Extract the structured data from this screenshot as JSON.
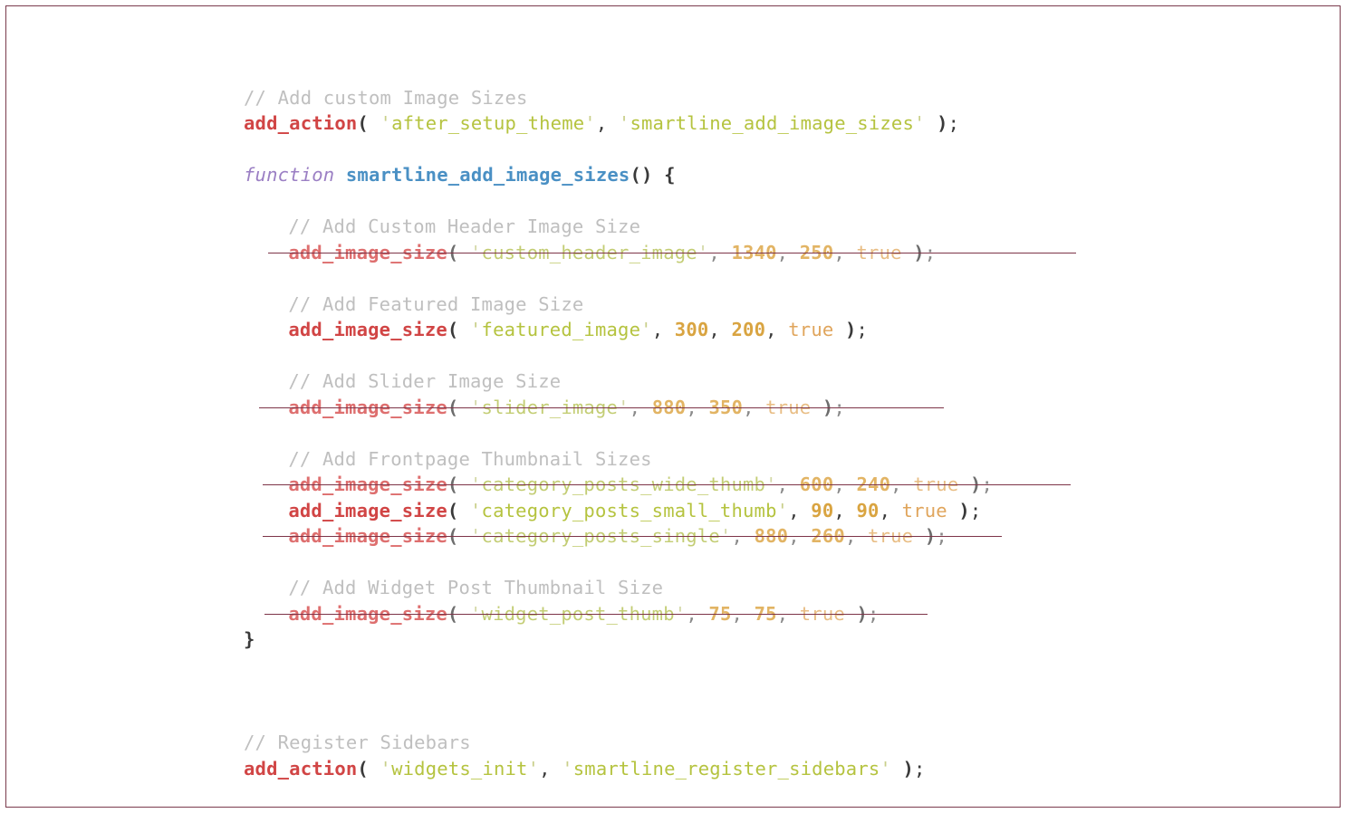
{
  "document": {
    "kind": "code-snippet-screenshot",
    "language": "PHP",
    "border_color": "#7a3b4d",
    "background_color": "#ffffff"
  },
  "theme": {
    "comment": "#bfbfbf",
    "function_call": "#d14545",
    "keyword": "#9b7fc4",
    "function_name": "#4a90c4",
    "string": "#b5c33f",
    "number": "#d9a441",
    "boolean": "#e0a55c",
    "punctuation": "#3a3a3a",
    "strikethrough": "#7d3448"
  },
  "code": {
    "lines": [
      {
        "id": "l1",
        "indent": 0,
        "struck": false,
        "text": "// Add custom Image Sizes",
        "tokens": [
          {
            "t": "comment",
            "v": "// Add custom Image Sizes"
          }
        ]
      },
      {
        "id": "l2",
        "indent": 0,
        "struck": false,
        "text": "add_action( 'after_setup_theme', 'smartline_add_image_sizes' );",
        "tokens": [
          {
            "t": "fn-call",
            "v": "add_action"
          },
          {
            "t": "punct",
            "v": "("
          },
          {
            "t": "plain",
            "v": " "
          },
          {
            "t": "quote",
            "v": "'"
          },
          {
            "t": "string",
            "v": "after_setup_theme"
          },
          {
            "t": "quote",
            "v": "'"
          },
          {
            "t": "comma",
            "v": ","
          },
          {
            "t": "plain",
            "v": " "
          },
          {
            "t": "quote",
            "v": "'"
          },
          {
            "t": "string",
            "v": "smartline_add_image_sizes"
          },
          {
            "t": "quote",
            "v": "'"
          },
          {
            "t": "plain",
            "v": " "
          },
          {
            "t": "punct",
            "v": ")"
          },
          {
            "t": "comma",
            "v": ";"
          }
        ]
      },
      {
        "id": "l3",
        "indent": 0,
        "struck": false,
        "text": "",
        "tokens": []
      },
      {
        "id": "l4",
        "indent": 0,
        "struck": false,
        "text": "function smartline_add_image_sizes() {",
        "tokens": [
          {
            "t": "keyword",
            "v": "function"
          },
          {
            "t": "plain",
            "v": " "
          },
          {
            "t": "fn-name",
            "v": "smartline_add_image_sizes"
          },
          {
            "t": "punct",
            "v": "()"
          },
          {
            "t": "plain",
            "v": " "
          },
          {
            "t": "punct",
            "v": "{"
          }
        ]
      },
      {
        "id": "l5",
        "indent": 0,
        "struck": false,
        "text": "",
        "tokens": []
      },
      {
        "id": "l6",
        "indent": 1,
        "struck": false,
        "text": "// Add Custom Header Image Size",
        "tokens": [
          {
            "t": "comment",
            "v": "// Add Custom Header Image Size"
          }
        ]
      },
      {
        "id": "l7",
        "indent": 1,
        "struck": true,
        "strike_start": -22,
        "strike_end": 870,
        "text": "add_image_size( 'custom_header_image', 1340, 250, true );",
        "tokens": [
          {
            "t": "fn-call",
            "v": "add_image_size"
          },
          {
            "t": "punct",
            "v": "("
          },
          {
            "t": "plain",
            "v": " "
          },
          {
            "t": "quote",
            "v": "'"
          },
          {
            "t": "string",
            "v": "custom_header_image"
          },
          {
            "t": "quote",
            "v": "'"
          },
          {
            "t": "comma",
            "v": ","
          },
          {
            "t": "plain",
            "v": " "
          },
          {
            "t": "number",
            "v": "1340"
          },
          {
            "t": "comma",
            "v": ","
          },
          {
            "t": "plain",
            "v": " "
          },
          {
            "t": "number",
            "v": "250"
          },
          {
            "t": "comma",
            "v": ","
          },
          {
            "t": "plain",
            "v": " "
          },
          {
            "t": "bool",
            "v": "true"
          },
          {
            "t": "plain",
            "v": " "
          },
          {
            "t": "punct",
            "v": ")"
          },
          {
            "t": "comma",
            "v": ";"
          }
        ]
      },
      {
        "id": "l8",
        "indent": 0,
        "struck": false,
        "text": "",
        "tokens": []
      },
      {
        "id": "l9",
        "indent": 1,
        "struck": false,
        "text": "// Add Featured Image Size",
        "tokens": [
          {
            "t": "comment",
            "v": "// Add Featured Image Size"
          }
        ]
      },
      {
        "id": "l10",
        "indent": 1,
        "struck": false,
        "text": "add_image_size( 'featured_image', 300, 200, true );",
        "tokens": [
          {
            "t": "fn-call",
            "v": "add_image_size"
          },
          {
            "t": "punct",
            "v": "("
          },
          {
            "t": "plain",
            "v": " "
          },
          {
            "t": "quote",
            "v": "'"
          },
          {
            "t": "string",
            "v": "featured_image"
          },
          {
            "t": "quote",
            "v": "'"
          },
          {
            "t": "comma",
            "v": ","
          },
          {
            "t": "plain",
            "v": " "
          },
          {
            "t": "number",
            "v": "300"
          },
          {
            "t": "comma",
            "v": ","
          },
          {
            "t": "plain",
            "v": " "
          },
          {
            "t": "number",
            "v": "200"
          },
          {
            "t": "comma",
            "v": ","
          },
          {
            "t": "plain",
            "v": " "
          },
          {
            "t": "bool",
            "v": "true"
          },
          {
            "t": "plain",
            "v": " "
          },
          {
            "t": "punct",
            "v": ")"
          },
          {
            "t": "comma",
            "v": ";"
          }
        ]
      },
      {
        "id": "l11",
        "indent": 0,
        "struck": false,
        "text": "",
        "tokens": []
      },
      {
        "id": "l12",
        "indent": 1,
        "struck": false,
        "text": "// Add Slider Image Size",
        "tokens": [
          {
            "t": "comment",
            "v": "// Add Slider Image Size"
          }
        ]
      },
      {
        "id": "l13",
        "indent": 1,
        "struck": true,
        "strike_start": -32,
        "strike_end": 724,
        "text": "add_image_size( 'slider_image', 880, 350, true );",
        "tokens": [
          {
            "t": "fn-call",
            "v": "add_image_size"
          },
          {
            "t": "punct",
            "v": "("
          },
          {
            "t": "plain",
            "v": " "
          },
          {
            "t": "quote",
            "v": "'"
          },
          {
            "t": "string",
            "v": "slider_image"
          },
          {
            "t": "quote",
            "v": "'"
          },
          {
            "t": "comma",
            "v": ","
          },
          {
            "t": "plain",
            "v": " "
          },
          {
            "t": "number",
            "v": "880"
          },
          {
            "t": "comma",
            "v": ","
          },
          {
            "t": "plain",
            "v": " "
          },
          {
            "t": "number",
            "v": "350"
          },
          {
            "t": "comma",
            "v": ","
          },
          {
            "t": "plain",
            "v": " "
          },
          {
            "t": "bool",
            "v": "true"
          },
          {
            "t": "plain",
            "v": " "
          },
          {
            "t": "punct",
            "v": ")"
          },
          {
            "t": "comma",
            "v": ";"
          }
        ]
      },
      {
        "id": "l14",
        "indent": 0,
        "struck": false,
        "text": "",
        "tokens": []
      },
      {
        "id": "l15",
        "indent": 1,
        "struck": false,
        "text": "// Add Frontpage Thumbnail Sizes",
        "tokens": [
          {
            "t": "comment",
            "v": "// Add Frontpage Thumbnail Sizes"
          }
        ]
      },
      {
        "id": "l16",
        "indent": 1,
        "struck": true,
        "strike_start": -28,
        "strike_end": 864,
        "text": "add_image_size( 'category_posts_wide_thumb', 600, 240, true );",
        "tokens": [
          {
            "t": "fn-call",
            "v": "add_image_size"
          },
          {
            "t": "punct",
            "v": "("
          },
          {
            "t": "plain",
            "v": " "
          },
          {
            "t": "quote",
            "v": "'"
          },
          {
            "t": "string",
            "v": "category_posts_wide_thumb"
          },
          {
            "t": "quote",
            "v": "'"
          },
          {
            "t": "comma",
            "v": ","
          },
          {
            "t": "plain",
            "v": " "
          },
          {
            "t": "number",
            "v": "600"
          },
          {
            "t": "comma",
            "v": ","
          },
          {
            "t": "plain",
            "v": " "
          },
          {
            "t": "number",
            "v": "240"
          },
          {
            "t": "comma",
            "v": ","
          },
          {
            "t": "plain",
            "v": " "
          },
          {
            "t": "bool",
            "v": "true"
          },
          {
            "t": "plain",
            "v": " "
          },
          {
            "t": "punct",
            "v": ")"
          },
          {
            "t": "comma",
            "v": ";"
          }
        ]
      },
      {
        "id": "l17",
        "indent": 1,
        "struck": false,
        "text": "add_image_size( 'category_posts_small_thumb', 90, 90, true );",
        "tokens": [
          {
            "t": "fn-call",
            "v": "add_image_size"
          },
          {
            "t": "punct",
            "v": "("
          },
          {
            "t": "plain",
            "v": " "
          },
          {
            "t": "quote",
            "v": "'"
          },
          {
            "t": "string",
            "v": "category_posts_small_thumb"
          },
          {
            "t": "quote",
            "v": "'"
          },
          {
            "t": "comma",
            "v": ","
          },
          {
            "t": "plain",
            "v": " "
          },
          {
            "t": "number",
            "v": "90"
          },
          {
            "t": "comma",
            "v": ","
          },
          {
            "t": "plain",
            "v": " "
          },
          {
            "t": "number",
            "v": "90"
          },
          {
            "t": "comma",
            "v": ","
          },
          {
            "t": "plain",
            "v": " "
          },
          {
            "t": "bool",
            "v": "true"
          },
          {
            "t": "plain",
            "v": " "
          },
          {
            "t": "punct",
            "v": ")"
          },
          {
            "t": "comma",
            "v": ";"
          }
        ]
      },
      {
        "id": "l18",
        "indent": 1,
        "struck": true,
        "strike_start": -28,
        "strike_end": 788,
        "text": "add_image_size( 'category_posts_single', 880, 260, true );",
        "tokens": [
          {
            "t": "fn-call",
            "v": "add_image_size"
          },
          {
            "t": "punct",
            "v": "("
          },
          {
            "t": "plain",
            "v": " "
          },
          {
            "t": "quote",
            "v": "'"
          },
          {
            "t": "string",
            "v": "category_posts_single"
          },
          {
            "t": "quote",
            "v": "'"
          },
          {
            "t": "comma",
            "v": ","
          },
          {
            "t": "plain",
            "v": " "
          },
          {
            "t": "number",
            "v": "880"
          },
          {
            "t": "comma",
            "v": ","
          },
          {
            "t": "plain",
            "v": " "
          },
          {
            "t": "number",
            "v": "260"
          },
          {
            "t": "comma",
            "v": ","
          },
          {
            "t": "plain",
            "v": " "
          },
          {
            "t": "bool",
            "v": "true"
          },
          {
            "t": "plain",
            "v": " "
          },
          {
            "t": "punct",
            "v": ")"
          },
          {
            "t": "comma",
            "v": ";"
          }
        ]
      },
      {
        "id": "l19",
        "indent": 0,
        "struck": false,
        "text": "",
        "tokens": []
      },
      {
        "id": "l20",
        "indent": 1,
        "struck": false,
        "text": "// Add Widget Post Thumbnail Size",
        "tokens": [
          {
            "t": "comment",
            "v": "// Add Widget Post Thumbnail Size"
          }
        ]
      },
      {
        "id": "l21",
        "indent": 1,
        "struck": true,
        "strike_start": -26,
        "strike_end": 706,
        "text": "add_image_size( 'widget_post_thumb', 75, 75, true );",
        "tokens": [
          {
            "t": "fn-call",
            "v": "add_image_size"
          },
          {
            "t": "punct",
            "v": "("
          },
          {
            "t": "plain",
            "v": " "
          },
          {
            "t": "quote",
            "v": "'"
          },
          {
            "t": "string",
            "v": "widget_post_thumb"
          },
          {
            "t": "quote",
            "v": "'"
          },
          {
            "t": "comma",
            "v": ","
          },
          {
            "t": "plain",
            "v": " "
          },
          {
            "t": "number",
            "v": "75"
          },
          {
            "t": "comma",
            "v": ","
          },
          {
            "t": "plain",
            "v": " "
          },
          {
            "t": "number",
            "v": "75"
          },
          {
            "t": "comma",
            "v": ","
          },
          {
            "t": "plain",
            "v": " "
          },
          {
            "t": "bool",
            "v": "true"
          },
          {
            "t": "plain",
            "v": " "
          },
          {
            "t": "punct",
            "v": ")"
          },
          {
            "t": "comma",
            "v": ";"
          }
        ]
      },
      {
        "id": "l22",
        "indent": 0,
        "struck": false,
        "text": "}",
        "tokens": [
          {
            "t": "punct",
            "v": "}"
          }
        ]
      },
      {
        "id": "l23",
        "indent": 0,
        "struck": false,
        "text": "",
        "tokens": []
      },
      {
        "id": "l24",
        "indent": 0,
        "struck": false,
        "text": "",
        "tokens": []
      },
      {
        "id": "l25",
        "indent": 0,
        "struck": false,
        "text": "",
        "tokens": []
      },
      {
        "id": "l26",
        "indent": 0,
        "struck": false,
        "text": "// Register Sidebars",
        "tokens": [
          {
            "t": "comment",
            "v": "// Register Sidebars"
          }
        ]
      },
      {
        "id": "l27",
        "indent": 0,
        "struck": false,
        "text": "add_action( 'widgets_init', 'smartline_register_sidebars' );",
        "tokens": [
          {
            "t": "fn-call",
            "v": "add_action"
          },
          {
            "t": "punct",
            "v": "("
          },
          {
            "t": "plain",
            "v": " "
          },
          {
            "t": "quote",
            "v": "'"
          },
          {
            "t": "string",
            "v": "widgets_init"
          },
          {
            "t": "quote",
            "v": "'"
          },
          {
            "t": "comma",
            "v": ","
          },
          {
            "t": "plain",
            "v": " "
          },
          {
            "t": "quote",
            "v": "'"
          },
          {
            "t": "string",
            "v": "smartline_register_sidebars"
          },
          {
            "t": "quote",
            "v": "'"
          },
          {
            "t": "plain",
            "v": " "
          },
          {
            "t": "punct",
            "v": ")"
          },
          {
            "t": "comma",
            "v": ";"
          }
        ]
      }
    ]
  }
}
